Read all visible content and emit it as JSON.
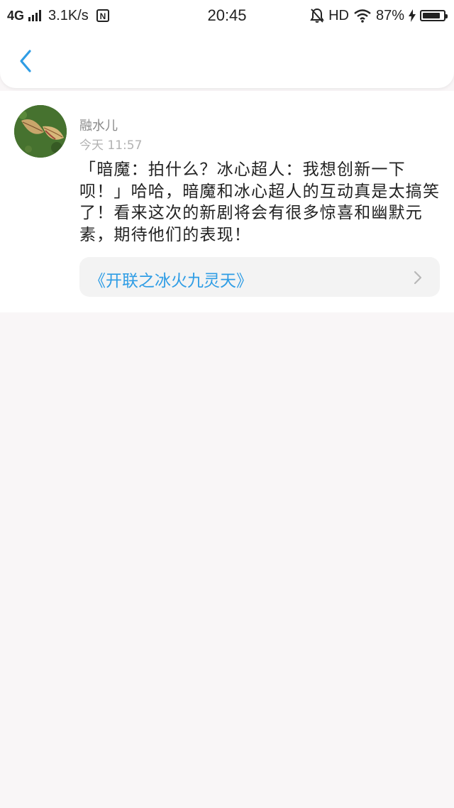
{
  "status_bar": {
    "network_type": "4G",
    "speed": "3.1K/s",
    "time": "20:45",
    "hd_label": "HD",
    "battery_percent": "87%",
    "battery_level": 0.87,
    "icons": [
      "signal-icon",
      "nfc-icon",
      "mute-bell-icon",
      "wifi-icon",
      "charging-icon",
      "battery-icon"
    ]
  },
  "nav": {
    "back_icon": "chevron-left-icon",
    "accent_color": "#2f9de5"
  },
  "post": {
    "username": "融水儿",
    "timestamp": "今天 11:57",
    "content": "「暗魔：拍什么？冰心超人：我想创新一下呗！」哈哈，暗魔和冰心超人的互动真是太搞笑了！看来这次的新剧将会有很多惊喜和幽默元素，期待他们的表现！",
    "link": {
      "title": "《开联之冰火九灵天》",
      "color": "#2f9de5",
      "chevron_icon": "chevron-right-icon"
    }
  }
}
